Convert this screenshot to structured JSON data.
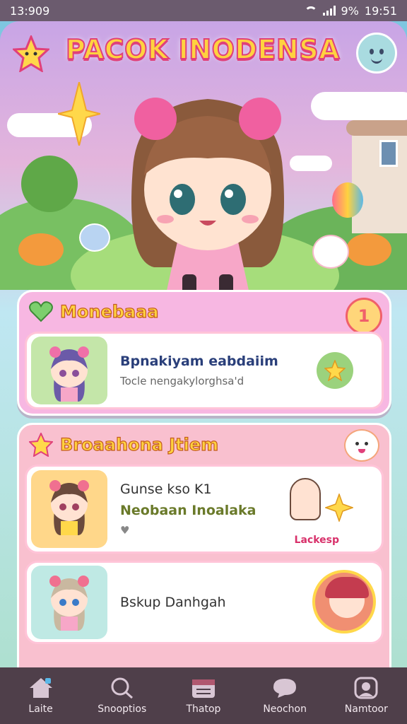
{
  "status_bar": {
    "time_left": "13:909",
    "battery": "9%",
    "time_right": "19:51"
  },
  "app_title": "PACOK INODENSA",
  "colors": {
    "accent_pink": "#e0407a",
    "title_yellow": "#ffd23f",
    "nav_bg": "#4f3f4a"
  },
  "sections": [
    {
      "title": "Monebaaa",
      "header_icon": "heart-icon",
      "badge": "1",
      "items": [
        {
          "line1": "Bpnakiyam eabdaiim",
          "line2": "Tocle nengakylorghsa'd"
        }
      ]
    },
    {
      "title": "Broaahona Jtiem",
      "header_icon": "star-icon",
      "items": [
        {
          "line1": "Gunse kso K1",
          "line2": "Neobaan Inoalaka",
          "line3": "",
          "tag": "Lackesp"
        },
        {
          "line1": "Bskup Danhgah"
        }
      ]
    }
  ],
  "nav": [
    {
      "label": "Laite",
      "icon": "home-icon"
    },
    {
      "label": "Snooptios",
      "icon": "search-icon"
    },
    {
      "label": "Thatop",
      "icon": "calendar-icon"
    },
    {
      "label": "Neochon",
      "icon": "chat-icon"
    },
    {
      "label": "Namtoor",
      "icon": "profile-icon"
    }
  ]
}
